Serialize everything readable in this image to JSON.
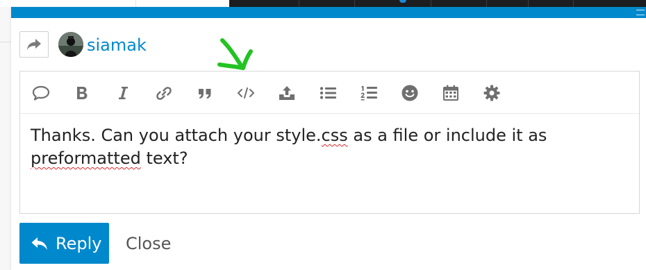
{
  "composer": {
    "user": {
      "username": "siamak"
    },
    "toolbar": {
      "buttons": [
        {
          "name": "quote-icon",
          "title": "Quote"
        },
        {
          "name": "bold-icon",
          "title": "Bold"
        },
        {
          "name": "italic-icon",
          "title": "Italic"
        },
        {
          "name": "link-icon",
          "title": "Hyperlink"
        },
        {
          "name": "blockquote-icon",
          "title": "Blockquote"
        },
        {
          "name": "code-icon",
          "title": "Preformatted text"
        },
        {
          "name": "upload-icon",
          "title": "Upload"
        },
        {
          "name": "bullet-list-icon",
          "title": "Bulleted list"
        },
        {
          "name": "numbered-list-icon",
          "title": "Numbered list"
        },
        {
          "name": "emoji-icon",
          "title": "Emoji"
        },
        {
          "name": "calendar-icon",
          "title": "Insert date"
        },
        {
          "name": "gear-icon",
          "title": "Options"
        }
      ]
    },
    "body": {
      "part1": "Thanks. Can you attach your style.",
      "misspelled1": "css",
      "part2": " as a file or include it as ",
      "misspelled2": "preformatted",
      "part3": " text?"
    },
    "actions": {
      "reply_label": "Reply",
      "close_label": "Close"
    }
  },
  "colors": {
    "accent": "#0088cc",
    "icon": "#6f6f6f",
    "annotation": "#22c322",
    "spellcheck": "#e0262a"
  }
}
